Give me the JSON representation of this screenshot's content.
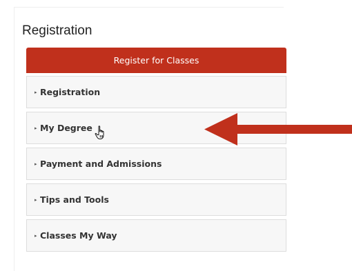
{
  "panel": {
    "title": "Registration",
    "register_button": "Register for Classes",
    "items": [
      {
        "label": "Registration",
        "caret": "▸"
      },
      {
        "label": "My Degree",
        "caret": "▸"
      },
      {
        "label": "Payment and Admissions",
        "caret": "▸"
      },
      {
        "label": "Tips and Tools",
        "caret": "▸"
      },
      {
        "label": "Classes My Way",
        "caret": "▸"
      }
    ]
  },
  "colors": {
    "register_button": "#c0301c",
    "annotation_arrow": "#c0301c"
  },
  "icons": {
    "cursor": "hand-pointer-icon",
    "annotation": "left-arrow-icon"
  }
}
